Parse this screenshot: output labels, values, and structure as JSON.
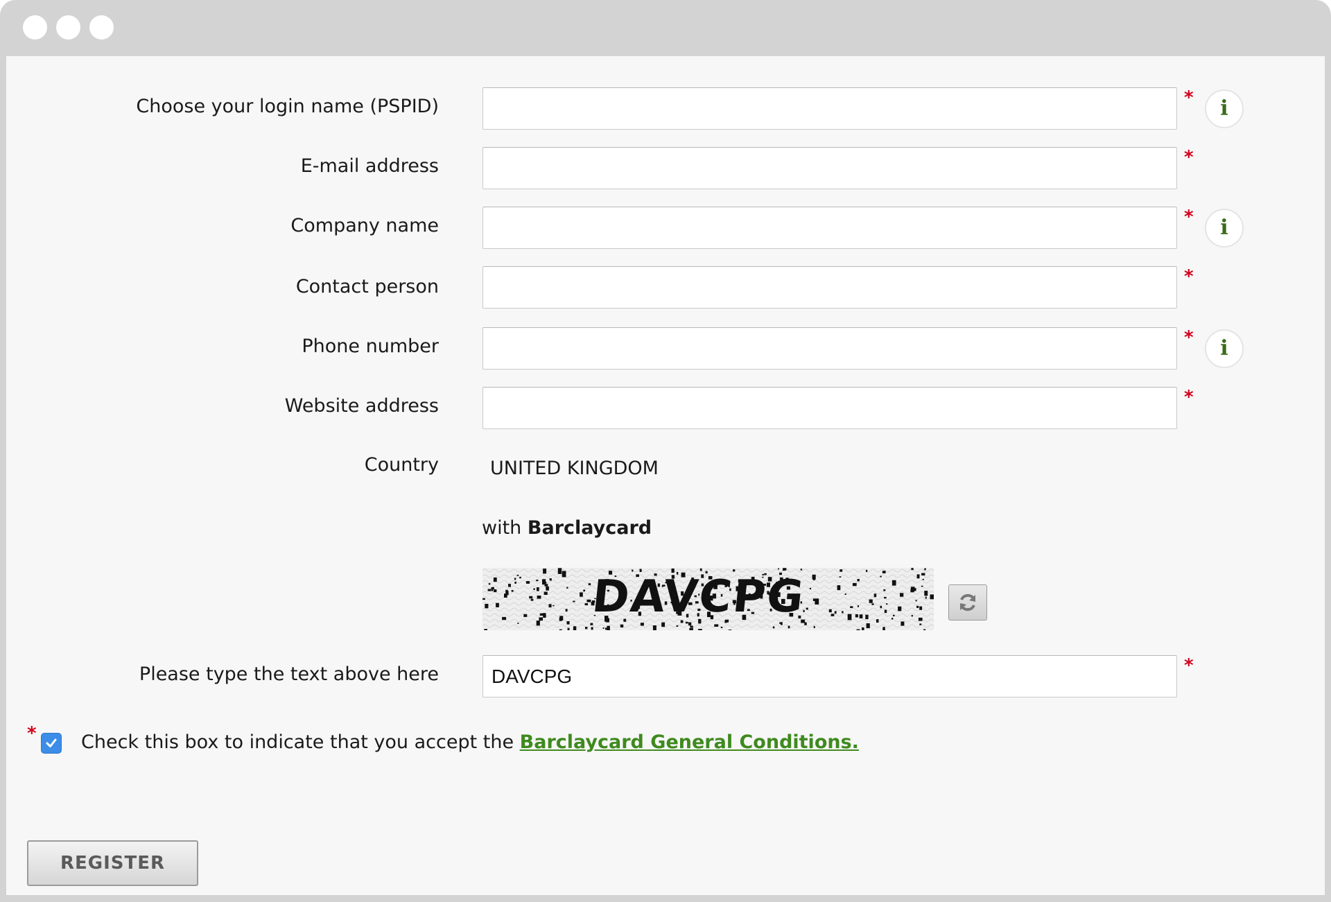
{
  "form": {
    "fields": [
      {
        "label": "Choose your login name (PSPID)",
        "value": "",
        "required_mark": "*",
        "info_icon": "i"
      },
      {
        "label": "E-mail address",
        "value": "",
        "required_mark": "*"
      },
      {
        "label": "Company name",
        "value": "",
        "required_mark": "*",
        "info_icon": "i"
      },
      {
        "label": "Contact person",
        "value": "",
        "required_mark": "*"
      },
      {
        "label": "Phone number",
        "value": "",
        "required_mark": "*",
        "info_icon": "i"
      },
      {
        "label": "Website address",
        "value": "",
        "required_mark": "*"
      }
    ],
    "country": {
      "label": "Country",
      "value": "UNITED KINGDOM"
    },
    "with": {
      "prefix": "with",
      "brand": "Barclaycard"
    },
    "captcha": {
      "image_text": "DAVCPG",
      "refresh_icon": "refresh-icon"
    },
    "captcha_input": {
      "label": "Please type the text above here",
      "value": "DAVCPG",
      "required_mark": "*"
    },
    "accept": {
      "required_mark": "*",
      "checked": true,
      "text": "Check this box to indicate that you accept the",
      "link_text": "Barclaycard General Conditions."
    },
    "register_label": "REGISTER"
  },
  "colors": {
    "required": "#d0021b",
    "link": "#3f8a1f",
    "checkbox": "#3b8de8",
    "info_icon": "#3a6b1a"
  }
}
